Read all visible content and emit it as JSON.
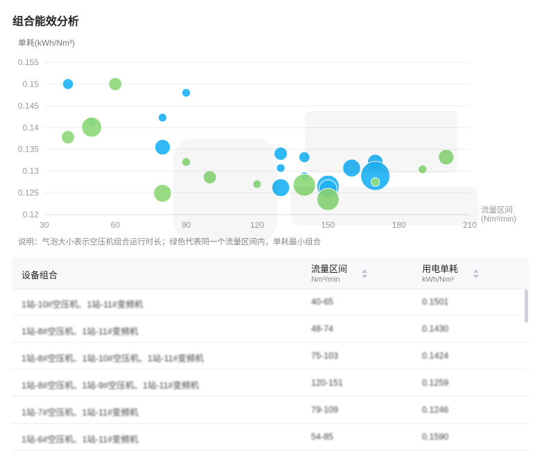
{
  "title": "组合能效分析",
  "note": "说明：气泡大小表示空压机组合运行时长；绿色代表同一个流量区间内，单耗最小组合",
  "colors": {
    "blue": "#1fb3f5",
    "green": "#8ed97a",
    "grid": "#ebeef2",
    "axis_text": "#999999"
  },
  "chart_data": {
    "type": "scatter",
    "title": "",
    "ylabel": "单耗(kWh/Nm³)",
    "xlabel": "流量区间\n(Nm³/min)",
    "xlim": [
      30,
      210
    ],
    "ylim": [
      0.12,
      0.155
    ],
    "xticks": [
      30,
      60,
      90,
      120,
      150,
      180,
      210
    ],
    "yticks": [
      0.12,
      0.125,
      0.13,
      0.135,
      0.14,
      0.145,
      0.15,
      0.155
    ],
    "grid": true,
    "series": [
      {
        "color": "blue",
        "points": [
          {
            "x": 40,
            "y": 0.15,
            "size": 2
          },
          {
            "x": 50,
            "y": 0.1413,
            "size": 1
          },
          {
            "x": 80,
            "y": 0.1423,
            "size": 1
          },
          {
            "x": 90,
            "y": 0.148,
            "size": 1
          },
          {
            "x": 80,
            "y": 0.1355,
            "size": 4
          },
          {
            "x": 130,
            "y": 0.134,
            "size": 3
          },
          {
            "x": 130,
            "y": 0.1307,
            "size": 1
          },
          {
            "x": 130,
            "y": 0.1262,
            "size": 5
          },
          {
            "x": 140,
            "y": 0.1332,
            "size": 2
          },
          {
            "x": 140,
            "y": 0.1288,
            "size": 1
          },
          {
            "x": 150,
            "y": 0.1265,
            "size": 7
          },
          {
            "x": 150,
            "y": 0.126,
            "size": 5
          },
          {
            "x": 160,
            "y": 0.1307,
            "size": 5
          },
          {
            "x": 170,
            "y": 0.1321,
            "size": 4
          },
          {
            "x": 170,
            "y": 0.1289,
            "size": 10
          }
        ]
      },
      {
        "color": "green",
        "points": [
          {
            "x": 40,
            "y": 0.1378,
            "size": 3
          },
          {
            "x": 50,
            "y": 0.1401,
            "size": 6
          },
          {
            "x": 60,
            "y": 0.15,
            "size": 3
          },
          {
            "x": 80,
            "y": 0.1249,
            "size": 5
          },
          {
            "x": 90,
            "y": 0.1321,
            "size": 1
          },
          {
            "x": 100,
            "y": 0.1286,
            "size": 3
          },
          {
            "x": 120,
            "y": 0.127,
            "size": 1
          },
          {
            "x": 140,
            "y": 0.1268,
            "size": 7
          },
          {
            "x": 150,
            "y": 0.1235,
            "size": 7
          },
          {
            "x": 170,
            "y": 0.1275,
            "size": 1
          },
          {
            "x": 190,
            "y": 0.1304,
            "size": 1
          },
          {
            "x": 200,
            "y": 0.1332,
            "size": 4
          }
        ]
      }
    ]
  },
  "table": {
    "columns": [
      {
        "label": "设备组合",
        "sub": ""
      },
      {
        "label": "流量区间",
        "sub": "Nm³/min"
      },
      {
        "label": "用电单耗",
        "sub": "kWh/Nm³"
      }
    ],
    "rows": [
      {
        "combo": "1站-10#空压机、1站-11#变频机",
        "flow": "40-65",
        "unit": "0.1501"
      },
      {
        "combo": "1站-8#空压机、1站-11#变频机",
        "flow": "48-74",
        "unit": "0.1430"
      },
      {
        "combo": "1站-8#空压机、1站-10#空压机、1站-11#变频机",
        "flow": "75-103",
        "unit": "0.1424"
      },
      {
        "combo": "1站-8#空压机、1站-9#空压机、1站-11#变频机",
        "flow": "120-151",
        "unit": "0.1259"
      },
      {
        "combo": "1站-7#空压机、1站-11#变频机",
        "flow": "79-109",
        "unit": "0.1246"
      },
      {
        "combo": "1站-6#空压机、1站-11#变频机",
        "flow": "54-85",
        "unit": "0.1590"
      }
    ]
  }
}
